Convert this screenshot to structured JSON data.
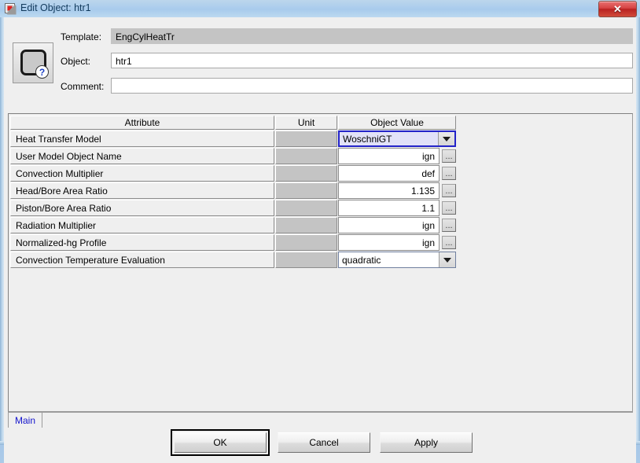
{
  "window": {
    "title": "Edit Object: htr1",
    "icon": "app-window-icon",
    "close_label": "✕",
    "glass_text_1": "",
    "glass_text_2": ""
  },
  "header": {
    "object_icon": "rounded-square-help-icon",
    "help_badge": "?",
    "template_label": "Template:",
    "template_value": "EngCylHeatTr",
    "object_label": "Object:",
    "object_value": "htr1",
    "comment_label": "Comment:",
    "comment_value": "",
    "comment_placeholder": ""
  },
  "table": {
    "columns": [
      "Attribute",
      "Unit",
      "Object Value"
    ],
    "rows": [
      {
        "attribute": "Heat Transfer Model",
        "unit": "",
        "value": "WoschniGT",
        "editor": "combo",
        "selected": true
      },
      {
        "attribute": "User Model Object Name",
        "unit": "",
        "value": "ign",
        "editor": "text",
        "selected": false
      },
      {
        "attribute": "Convection Multiplier",
        "unit": "",
        "value": "def",
        "editor": "text",
        "selected": false
      },
      {
        "attribute": "Head/Bore Area Ratio",
        "unit": "",
        "value": "1.135",
        "editor": "text",
        "selected": false
      },
      {
        "attribute": "Piston/Bore Area Ratio",
        "unit": "",
        "value": "1.1",
        "editor": "text",
        "selected": false
      },
      {
        "attribute": "Radiation Multiplier",
        "unit": "",
        "value": "ign",
        "editor": "text",
        "selected": false
      },
      {
        "attribute": "Normalized-hg Profile",
        "unit": "",
        "value": "ign",
        "editor": "text",
        "selected": false
      },
      {
        "attribute": "Convection Temperature Evaluation",
        "unit": "",
        "value": "quadratic",
        "editor": "combo",
        "selected": false
      }
    ],
    "ellipsis_label": "..."
  },
  "tabs": [
    {
      "label": "Main",
      "active": true
    }
  ],
  "buttons": {
    "ok": "OK",
    "cancel": "Cancel",
    "apply": "Apply"
  },
  "colors": {
    "accent_blue": "#2323c8",
    "selected_cell_bg": "#e2e2f8",
    "readonly_gray": "#c4c4c4",
    "panel_bg": "#efefef",
    "titlebar_text": "#123a5c",
    "tab_text": "#1414cc",
    "close_red": "#b92222"
  }
}
